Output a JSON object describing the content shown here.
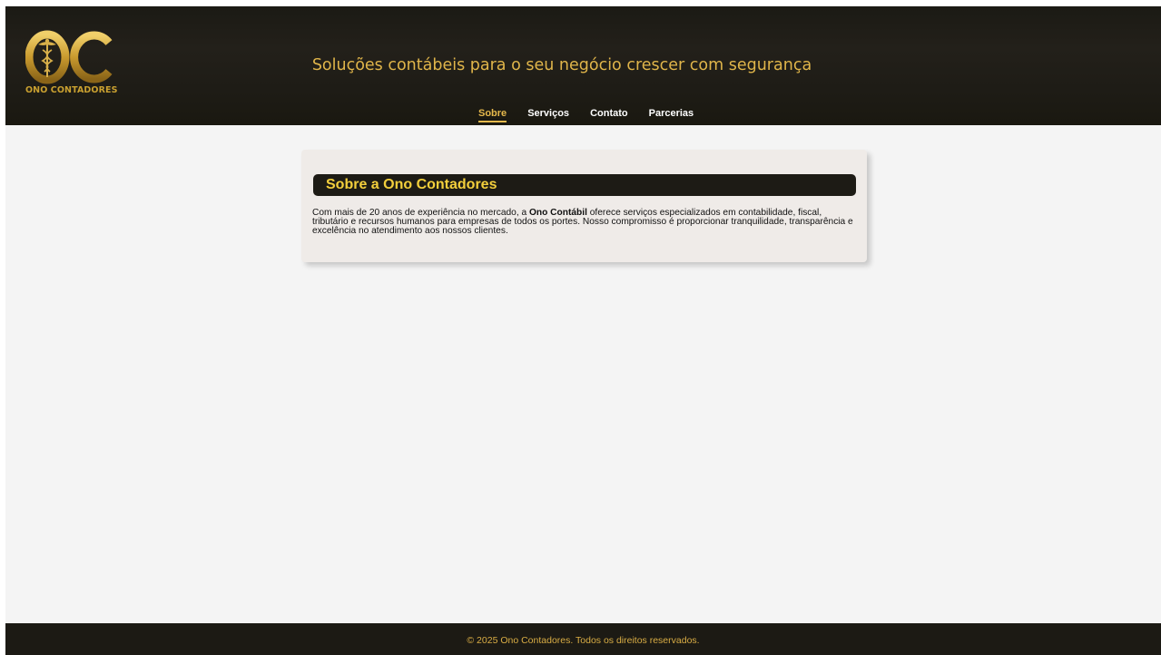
{
  "header": {
    "logo_text": "ONO CONTADORES",
    "tagline": "Soluções contábeis para o seu negócio crescer com segurança"
  },
  "nav": {
    "items": [
      {
        "label": "Sobre",
        "active": true
      },
      {
        "label": "Serviços",
        "active": false
      },
      {
        "label": "Contato",
        "active": false
      },
      {
        "label": "Parcerias",
        "active": false
      }
    ]
  },
  "about": {
    "title": "Sobre a Ono Contadores",
    "text_before": "Com mais de 20 anos de experiência no mercado, a ",
    "text_bold": "Ono Contábil",
    "text_after": " oferece serviços especializados em contabilidade, fiscal, tributário e recursos humanos para empresas de todos os portes. Nosso compromisso é proporcionar tranquilidade, transparência e excelência no atendimento aos nossos clientes."
  },
  "footer": {
    "text": "© 2025 Ono Contadores. Todos os direitos reservados."
  },
  "colors": {
    "header_bg": "#1e1c16",
    "accent_gold": "#e0b54a",
    "title_yellow": "#f3cf3c",
    "page_bg": "#f4f4f4",
    "card_bg": "#efebe8"
  },
  "icons": {
    "logo": "oc-caduceus-logo-icon"
  }
}
